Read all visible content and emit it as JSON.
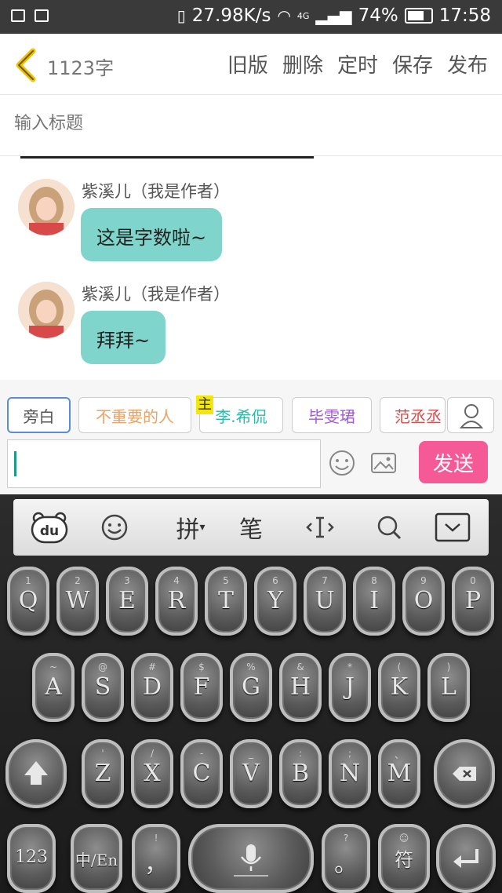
{
  "status_bar": {
    "net_speed": "27.98K/s",
    "net_type": "4G",
    "battery_percent": "74%",
    "battery_level": 0.74,
    "time": "17:58"
  },
  "header": {
    "word_count": "1123字",
    "menu": [
      "旧版",
      "删除",
      "定时",
      "保存",
      "发布"
    ]
  },
  "title_input": {
    "placeholder": "输入标题"
  },
  "messages": [
    {
      "author": "紫溪儿（我是作者）",
      "text": "这是字数啦~"
    },
    {
      "author": "紫溪儿（我是作者）",
      "text": "拜拜~"
    }
  ],
  "roles": {
    "items": [
      {
        "label": "旁白",
        "color": "#555555",
        "selected": true
      },
      {
        "label": "不重要的人",
        "color": "#f0a060"
      },
      {
        "label": "李.希侃",
        "color": "#2fb8a8",
        "tag": "主"
      },
      {
        "label": "毕雯珺",
        "color": "#a05ad6"
      },
      {
        "label": "范丞丞",
        "color": "#e04a4a"
      }
    ]
  },
  "composer": {
    "send_label": "发送"
  },
  "keyboard": {
    "toolbar": {
      "logo": "du",
      "pinyin": "拼",
      "stroke": "笔"
    },
    "row1": [
      {
        "k": "Q",
        "s": "1"
      },
      {
        "k": "W",
        "s": "2"
      },
      {
        "k": "E",
        "s": "3"
      },
      {
        "k": "R",
        "s": "4"
      },
      {
        "k": "T",
        "s": "5"
      },
      {
        "k": "Y",
        "s": "6"
      },
      {
        "k": "U",
        "s": "7"
      },
      {
        "k": "I",
        "s": "8"
      },
      {
        "k": "O",
        "s": "9"
      },
      {
        "k": "P",
        "s": "0"
      }
    ],
    "row2": [
      {
        "k": "A",
        "s": "~"
      },
      {
        "k": "S",
        "s": "@"
      },
      {
        "k": "D",
        "s": "#"
      },
      {
        "k": "F",
        "s": "$"
      },
      {
        "k": "G",
        "s": "%"
      },
      {
        "k": "H",
        "s": "&"
      },
      {
        "k": "J",
        "s": "*"
      },
      {
        "k": "K",
        "s": "("
      },
      {
        "k": "L",
        "s": ")"
      }
    ],
    "row3": [
      {
        "k": "Z",
        "s": "'"
      },
      {
        "k": "X",
        "s": "/"
      },
      {
        "k": "C",
        "s": "-"
      },
      {
        "k": "V",
        "s": "_"
      },
      {
        "k": "B",
        "s": ":"
      },
      {
        "k": "N",
        "s": ";"
      },
      {
        "k": "M",
        "s": "、"
      }
    ],
    "row4": {
      "num": "123",
      "lang": "中/En",
      "comma": "，",
      "comma_sub": "!",
      "period": "。",
      "period_sub": "?",
      "symbols": "符"
    }
  }
}
